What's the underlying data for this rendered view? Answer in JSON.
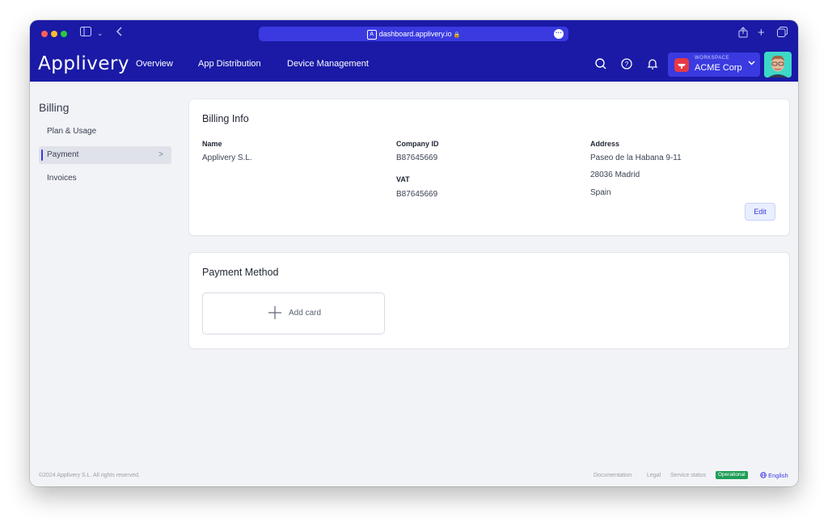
{
  "browser": {
    "url": "dashboard.applivery.io"
  },
  "header": {
    "brand": "Applivery",
    "nav": [
      "Overview",
      "App Distribution",
      "Device Management"
    ],
    "workspace": {
      "label": "WORKSPACE",
      "name": "ACME Corp"
    },
    "icons": [
      "search-icon",
      "help-icon",
      "bell-icon",
      "user-avatar"
    ]
  },
  "sidebar": {
    "title": "Billing",
    "items": [
      {
        "label": "Plan & Usage",
        "active": false
      },
      {
        "label": "Payment",
        "active": true
      },
      {
        "label": "Invoices",
        "active": false
      }
    ]
  },
  "billing_info": {
    "title": "Billing Info",
    "name_label": "Name",
    "name_value": "Applivery S.L.",
    "company_id_label": "Company ID",
    "company_id_value": "B87645669",
    "vat_label": "VAT",
    "vat_value": "B87645669",
    "address_label": "Address",
    "address_lines": [
      "Paseo de la Habana 9-11",
      "28036 Madrid",
      "Spain"
    ],
    "edit_label": "Edit"
  },
  "payment_method": {
    "title": "Payment Method",
    "add_card_label": "Add card"
  },
  "footer": {
    "copyright": "©2024 Applivery S.L. All rights reserved.",
    "links": [
      "Documentation",
      "Legal",
      "Service status"
    ],
    "status_badge": "Operational",
    "language": "English"
  },
  "colors": {
    "header_bg": "#1a1aa6",
    "accent": "#3a3ae0",
    "status_green": "#1e9e57"
  }
}
